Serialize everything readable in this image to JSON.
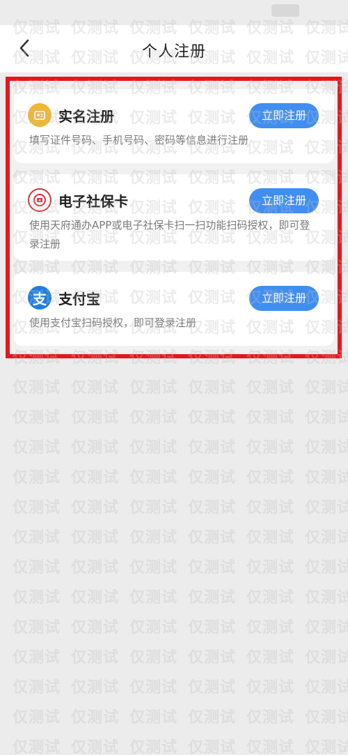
{
  "header": {
    "title": "个人注册",
    "back_icon": "chevron-left-icon"
  },
  "cards": [
    {
      "title": "实名注册",
      "desc": "填写证件号码、手机号码、密码等信息进行注册",
      "button": "立即注册",
      "icon": "id-card-icon",
      "icon_color": "#f2b632"
    },
    {
      "title": "电子社保卡",
      "desc": "使用天府通办APP或电子社保卡扫一扫功能扫码授权，即可登录注册",
      "button": "立即注册",
      "icon": "social-security-icon",
      "icon_color": "#d6323a"
    },
    {
      "title": "支付宝",
      "desc": "使用支付宝扫码授权，即可登录注册",
      "button": "立即注册",
      "icon": "alipay-icon",
      "icon_glyph": "支",
      "icon_color": "#1f7fe0"
    }
  ],
  "colors": {
    "button": "#3f8ef2",
    "highlight_border": "#e8161b",
    "background": "#ececec"
  },
  "watermark": {
    "text": "仅测试"
  }
}
